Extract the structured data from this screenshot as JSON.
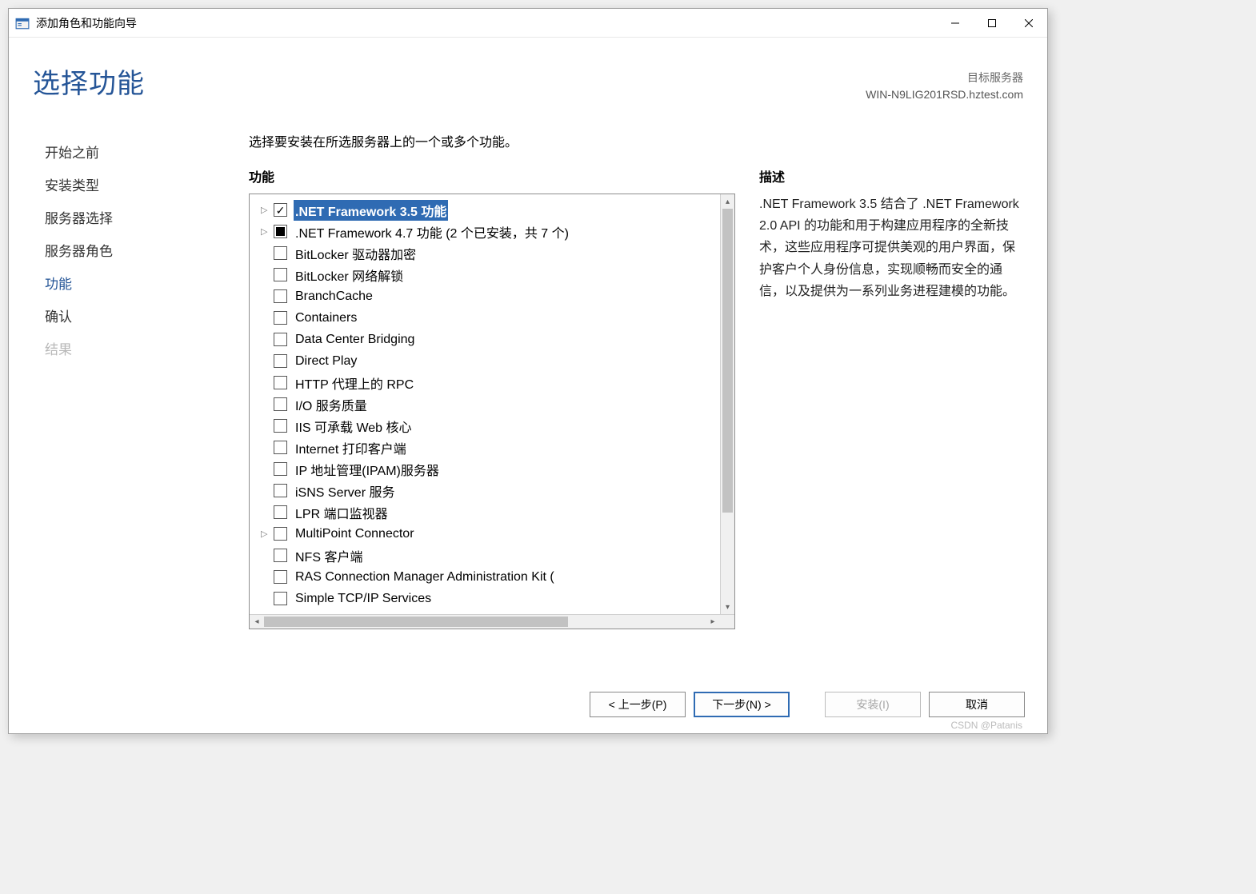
{
  "window": {
    "title": "添加角色和功能向导"
  },
  "header": {
    "page_title": "选择功能",
    "target_label": "目标服务器",
    "target_server": "WIN-N9LIG201RSD.hztest.com"
  },
  "sidebar": {
    "items": [
      {
        "label": "开始之前",
        "state": "normal"
      },
      {
        "label": "安装类型",
        "state": "normal"
      },
      {
        "label": "服务器选择",
        "state": "normal"
      },
      {
        "label": "服务器角色",
        "state": "normal"
      },
      {
        "label": "功能",
        "state": "active"
      },
      {
        "label": "确认",
        "state": "normal"
      },
      {
        "label": "结果",
        "state": "disabled"
      }
    ]
  },
  "main": {
    "instruction": "选择要安装在所选服务器上的一个或多个功能。",
    "features_label": "功能",
    "description_label": "描述",
    "description_text": ".NET Framework 3.5 结合了 .NET Framework 2.0 API 的功能和用于构建应用程序的全新技术，这些应用程序可提供美观的用户界面，保护客户个人身份信息，实现顺畅而安全的通信，以及提供为一系列业务进程建模的功能。"
  },
  "features": [
    {
      "label": ".NET Framework 3.5 功能",
      "checkbox": "checked",
      "expandable": true,
      "selected": true
    },
    {
      "label": ".NET Framework 4.7 功能 (2 个已安装，共 7 个)",
      "checkbox": "partial",
      "expandable": true
    },
    {
      "label": "BitLocker 驱动器加密",
      "checkbox": "unchecked"
    },
    {
      "label": "BitLocker 网络解锁",
      "checkbox": "unchecked"
    },
    {
      "label": "BranchCache",
      "checkbox": "unchecked"
    },
    {
      "label": "Containers",
      "checkbox": "unchecked"
    },
    {
      "label": "Data Center Bridging",
      "checkbox": "unchecked"
    },
    {
      "label": "Direct Play",
      "checkbox": "unchecked"
    },
    {
      "label": "HTTP 代理上的 RPC",
      "checkbox": "unchecked"
    },
    {
      "label": "I/O 服务质量",
      "checkbox": "unchecked"
    },
    {
      "label": "IIS 可承载 Web 核心",
      "checkbox": "unchecked"
    },
    {
      "label": "Internet 打印客户端",
      "checkbox": "unchecked"
    },
    {
      "label": "IP 地址管理(IPAM)服务器",
      "checkbox": "unchecked"
    },
    {
      "label": "iSNS Server 服务",
      "checkbox": "unchecked"
    },
    {
      "label": "LPR 端口监视器",
      "checkbox": "unchecked"
    },
    {
      "label": "MultiPoint Connector",
      "checkbox": "unchecked",
      "expandable": true
    },
    {
      "label": "NFS 客户端",
      "checkbox": "unchecked"
    },
    {
      "label": "RAS Connection Manager Administration Kit (",
      "checkbox": "unchecked"
    },
    {
      "label": "Simple TCP/IP Services",
      "checkbox": "unchecked"
    }
  ],
  "footer": {
    "previous": "< 上一步(P)",
    "next": "下一步(N) >",
    "install": "安装(I)",
    "cancel": "取消"
  },
  "watermark": "CSDN @Patanis"
}
